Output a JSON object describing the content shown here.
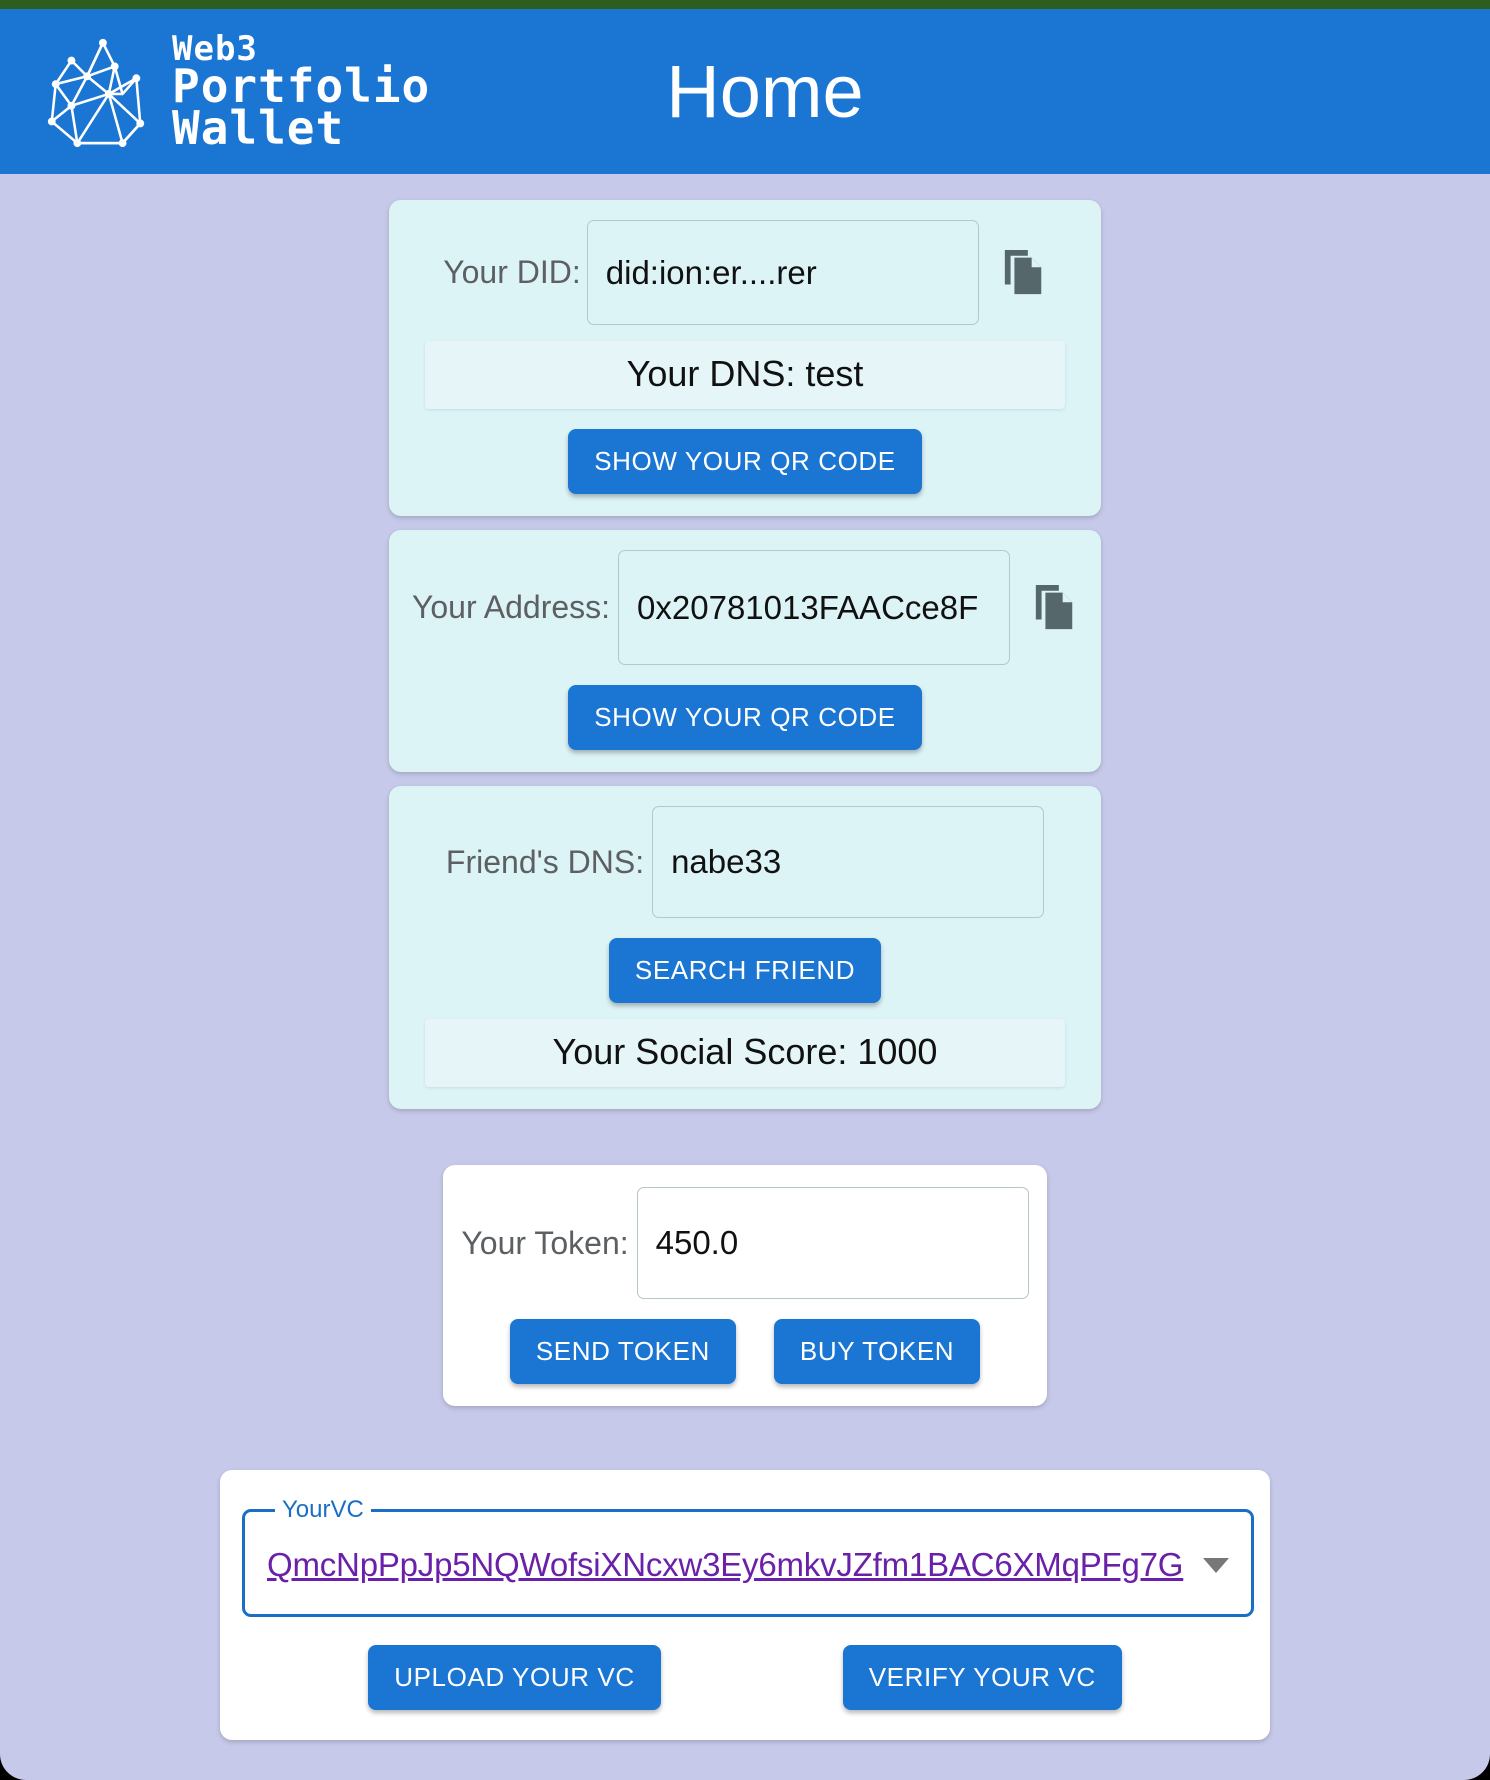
{
  "header": {
    "title": "Home",
    "brand_line1": "Web3",
    "brand_line2": "Portfolio",
    "brand_line3": "Wallet",
    "accent_color": "#1a76d2",
    "top_strip_color": "#2d5e1f"
  },
  "did_card": {
    "label": "Your DID:",
    "value": "did:ion:er....rer",
    "dns_info": "Your DNS: test",
    "qr_button": "SHOW YOUR QR CODE",
    "copy_icon": "copy-icon"
  },
  "address_card": {
    "label": "Your Address:",
    "value": "0x20781013FAACce8F",
    "qr_button": "SHOW YOUR QR CODE",
    "copy_icon": "copy-icon"
  },
  "friend_card": {
    "label": "Friend's DNS:",
    "value": "nabe33",
    "search_button": "SEARCH FRIEND",
    "social_score_info": "Your Social Score: 1000"
  },
  "token_card": {
    "label": "Your Token:",
    "value": "450.0",
    "send_button": "SEND TOKEN",
    "buy_button": "BUY TOKEN"
  },
  "vc_card": {
    "legend": "YourVC",
    "selected_value": "QmcNpPpJp5NQWofsiXNcxw3Ey6mkvJZfm1BAC6XMqPFg7G",
    "link_color": "#6a20a8",
    "upload_button": "UPLOAD YOUR VC",
    "verify_button": "VERIFY YOUR VC",
    "caret_icon": "chevron-down-icon"
  },
  "theme": {
    "page_background": "#c6c9e9",
    "card_background": "#ddf4f7",
    "button_color": "#1a76d2"
  }
}
